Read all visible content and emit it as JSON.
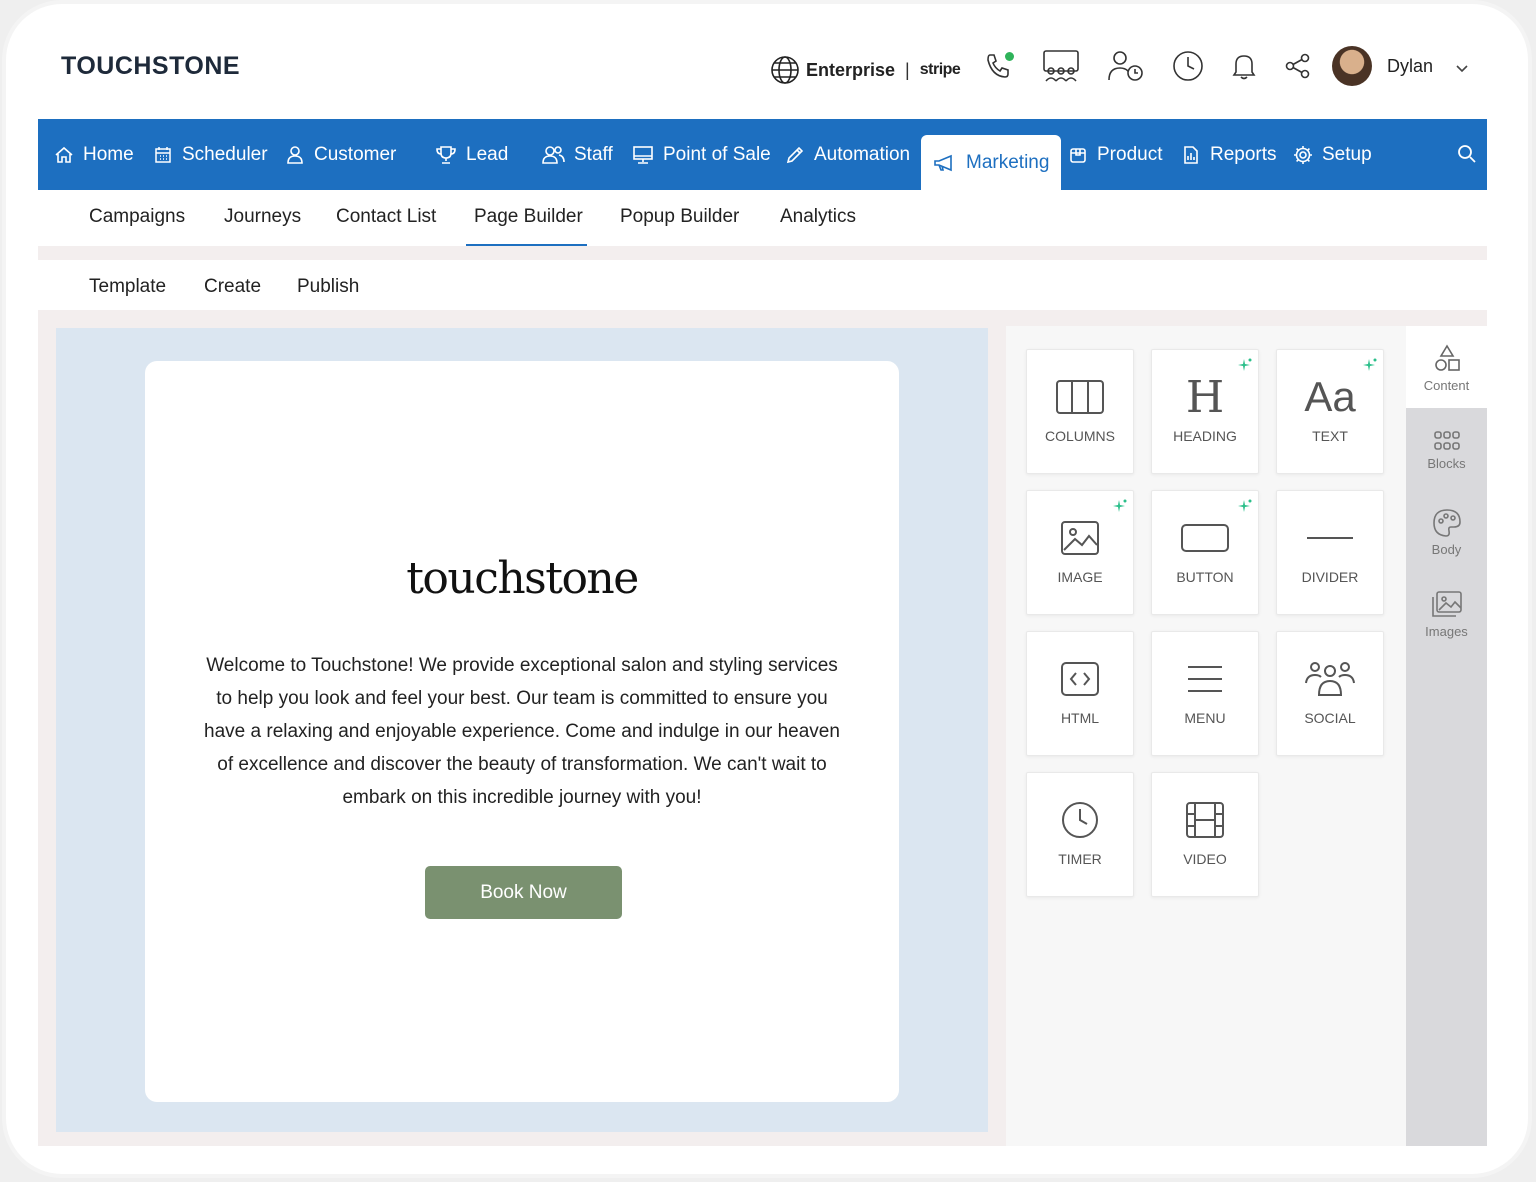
{
  "header": {
    "brand": "TOUCHSTONE",
    "enterprise_label": "Enterprise",
    "separator": "|",
    "stripe_label": "stripe",
    "user_name": "Dylan",
    "status_color": "#2fb35a"
  },
  "main_nav": {
    "items": [
      {
        "label": "Home",
        "icon": "home-icon"
      },
      {
        "label": "Scheduler",
        "icon": "calendar-icon"
      },
      {
        "label": "Customer",
        "icon": "person-icon"
      },
      {
        "label": "Lead",
        "icon": "trophy-icon"
      },
      {
        "label": "Staff",
        "icon": "group-icon"
      },
      {
        "label": "Point of Sale",
        "icon": "monitor-icon"
      },
      {
        "label": "Automation",
        "icon": "pencil-icon"
      },
      {
        "label": "Marketing",
        "icon": "megaphone-icon"
      },
      {
        "label": "Product",
        "icon": "box-icon"
      },
      {
        "label": "Reports",
        "icon": "report-icon"
      },
      {
        "label": "Setup",
        "icon": "gear-icon"
      }
    ],
    "active": "Marketing",
    "accent": "#1d6fc0"
  },
  "sub_nav": {
    "items": [
      "Campaigns",
      "Journeys",
      "Contact List",
      "Page Builder",
      "Popup Builder",
      "Analytics"
    ],
    "active": "Page Builder"
  },
  "tert_nav": {
    "items": [
      "Template",
      "Create",
      "Publish"
    ],
    "active": "Create"
  },
  "canvas": {
    "logo_text": "touchstone",
    "welcome_text": "Welcome to Touchstone! We provide exceptional salon and styling services to help you look and feel your best. Our team is committed to ensure you have a relaxing and enjoyable experience. Come and indulge in our heaven of excellence and discover the beauty of transformation. We can't wait to embark on this incredible journey with you!",
    "button_label": "Book Now",
    "button_color": "#7a9170"
  },
  "blocks": {
    "items": [
      {
        "label": "COLUMNS",
        "icon": "columns-icon",
        "ai": false
      },
      {
        "label": "HEADING",
        "icon": "heading-icon",
        "ai": true
      },
      {
        "label": "TEXT",
        "icon": "text-icon",
        "ai": true
      },
      {
        "label": "IMAGE",
        "icon": "image-icon",
        "ai": true
      },
      {
        "label": "BUTTON",
        "icon": "button-icon",
        "ai": true
      },
      {
        "label": "DIVIDER",
        "icon": "divider-icon",
        "ai": false
      },
      {
        "label": "HTML",
        "icon": "html-icon",
        "ai": false
      },
      {
        "label": "MENU",
        "icon": "menu-icon",
        "ai": false
      },
      {
        "label": "SOCIAL",
        "icon": "social-icon",
        "ai": false
      },
      {
        "label": "TIMER",
        "icon": "timer-icon",
        "ai": false
      },
      {
        "label": "VIDEO",
        "icon": "video-icon",
        "ai": false
      }
    ],
    "heading_glyph": "H",
    "text_glyph": "Aa",
    "ai_color": "#2bbf8a"
  },
  "rail": {
    "items": [
      "Content",
      "Blocks",
      "Body",
      "Images"
    ],
    "active": "Content"
  }
}
